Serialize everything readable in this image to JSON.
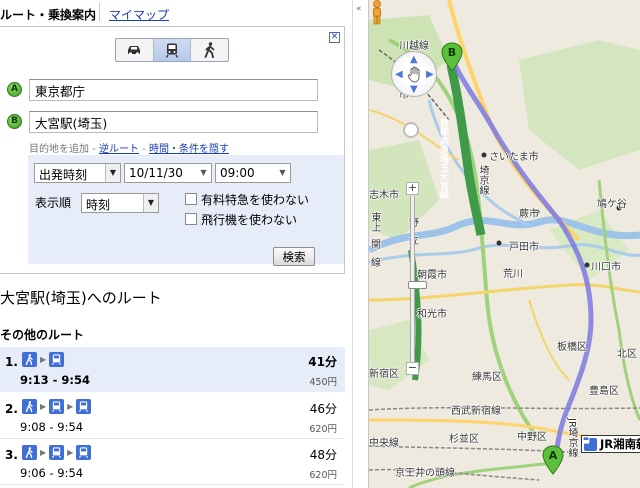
{
  "tabs": {
    "route": "ルート・乗換案内",
    "mymaps": "マイマップ"
  },
  "form": {
    "close_icon": "close-icon",
    "modes": [
      "car",
      "transit",
      "walk"
    ],
    "active_mode": "transit",
    "origin": {
      "marker": "A",
      "value": "東京都庁"
    },
    "destination": {
      "marker": "B",
      "value": "大宮駅(埼玉)"
    },
    "links": {
      "add_destination": "目的地を追加",
      "separator": "-",
      "reverse_route": "逆ルート",
      "hide_options": "時間・条件を隠す"
    },
    "time_type": "出発時刻",
    "date": "10/11/30",
    "time": "09:00",
    "sort_label": "表示順",
    "sort_value": "時刻",
    "option_express": "有料特急を使わない",
    "option_airplane": "飛行機を使わない",
    "search_button": "検索"
  },
  "results": {
    "title": "大宮駅(埼玉)へのルート",
    "other_title": "その他のルート",
    "routes": [
      {
        "num": "1.",
        "time": "9:13 - 9:54",
        "duration": "41分",
        "fare": "450円",
        "segments": [
          "walk",
          "train"
        ]
      },
      {
        "num": "2.",
        "time": "9:08 - 9:54",
        "duration": "46分",
        "fare": "620円",
        "segments": [
          "walk",
          "train",
          "train"
        ]
      },
      {
        "num": "3.",
        "time": "9:06 - 9:54",
        "duration": "48分",
        "fare": "620円",
        "segments": [
          "walk",
          "train",
          "train"
        ]
      }
    ]
  },
  "map": {
    "labels": {
      "kawagoe_line": "川越線",
      "saitama_city": "さいたま市",
      "shiki": "志木市",
      "warabi": "蕨市",
      "toda": "戸田市",
      "kawaguchi": "川口市",
      "asaka": "朝霞市",
      "wako": "和光市",
      "itabashi": "板橋区",
      "kita": "北区",
      "nerima": "練馬区",
      "toshima": "豊島区",
      "suginami": "杉並区",
      "nakano": "中野区",
      "nishi_waseda": "西武新宿線",
      "chuo_line": "中央線",
      "keio": "京王井の頭線",
      "arakawa": "荒川",
      "saikyo": "埼京線",
      "jr_saikyo": "JR埼京線",
      "shinjuku": "新宿区",
      "fukuchi": "鳩ケ谷",
      "mitaka": "市",
      "kawaguchi_road": "首都高速埼玉大宮線",
      "kan": "関",
      "sen": "線",
      "higashi": "東上",
      "ryou": "野",
      "ritsu": "立"
    },
    "jr_label": "JR湘南新",
    "pin_a": "A",
    "pin_b": "B",
    "route_color": "#7b79e0"
  }
}
